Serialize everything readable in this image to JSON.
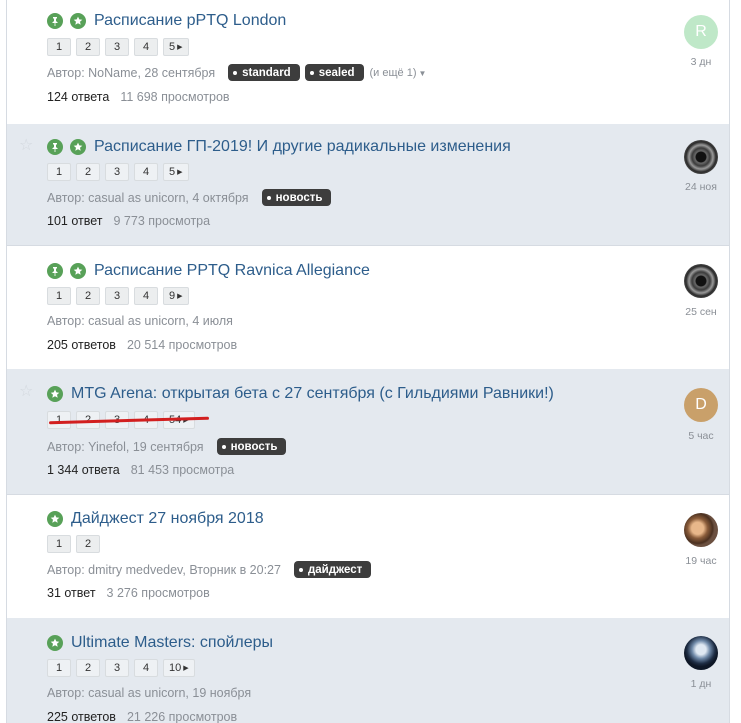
{
  "topics": [
    {
      "title": "Расписание pPTQ London",
      "pinned": true,
      "featured": true,
      "pages": [
        "1",
        "2",
        "3",
        "4",
        "5"
      ],
      "author_line": "Автор: NoName, 28 сентября",
      "tags": [
        "standard",
        "sealed"
      ],
      "more_tags": "(и ещё 1)",
      "replies": "124 ответа",
      "views": "11 698 просмотров",
      "avatar_letter": "R",
      "time": "3 дн"
    },
    {
      "title": "Расписание ГП-2019! И другие радикальные изменения",
      "pinned": true,
      "featured": true,
      "pages": [
        "1",
        "2",
        "3",
        "4",
        "5"
      ],
      "author_line": "Автор: casual as unicorn, 4 октября",
      "tags": [
        "новость"
      ],
      "replies": "101 ответ",
      "views": "9 773 просмотра",
      "time": "24 ноя"
    },
    {
      "title": "Расписание PPTQ Ravnica Allegiance",
      "pinned": true,
      "featured": true,
      "pages": [
        "1",
        "2",
        "3",
        "4",
        "9"
      ],
      "author_line": "Автор: casual as unicorn, 4 июля",
      "tags": [],
      "replies": "205 ответов",
      "views": "20 514 просмотров",
      "time": "25 сен"
    },
    {
      "title": "MTG Arena: открытая бета с 27 сентября (с Гильдиями Равники!)",
      "pinned": false,
      "featured": true,
      "pages": [
        "1",
        "2",
        "3",
        "4",
        "54"
      ],
      "author_line": "Автор: Yinefol, 19 сентября",
      "tags": [
        "новость"
      ],
      "replies": "1 344 ответа",
      "views": "81 453 просмотра",
      "avatar_letter": "D",
      "time": "5 час"
    },
    {
      "title": "Дайджест 27 ноября 2018",
      "pinned": false,
      "featured": true,
      "pages": [
        "1",
        "2"
      ],
      "author_line": "Автор: dmitry medvedev, Вторник в 20:27",
      "tags": [
        "дайджест"
      ],
      "replies": "31 ответ",
      "views": "3 276 просмотров",
      "time": "19 час"
    },
    {
      "title": "Ultimate Masters: спойлеры",
      "pinned": false,
      "featured": true,
      "pages": [
        "1",
        "2",
        "3",
        "4",
        "10"
      ],
      "author_line": "Автор: casual as unicorn, 19 ноября",
      "tags": [],
      "replies": "225 ответов",
      "views": "21 226 просмотров",
      "time": "1 дн"
    }
  ],
  "icons": {
    "pin": "pin-icon",
    "feature": "star-icon",
    "next": "caret-right-icon",
    "unfollow": "star-outline-icon"
  },
  "colors": {
    "title_link": "#2d5d8b",
    "icon_green": "#58a158",
    "alt_row": "#e4e9ef",
    "tag_bg": "#3d3d3d",
    "annotation_red": "#d21f1f"
  }
}
